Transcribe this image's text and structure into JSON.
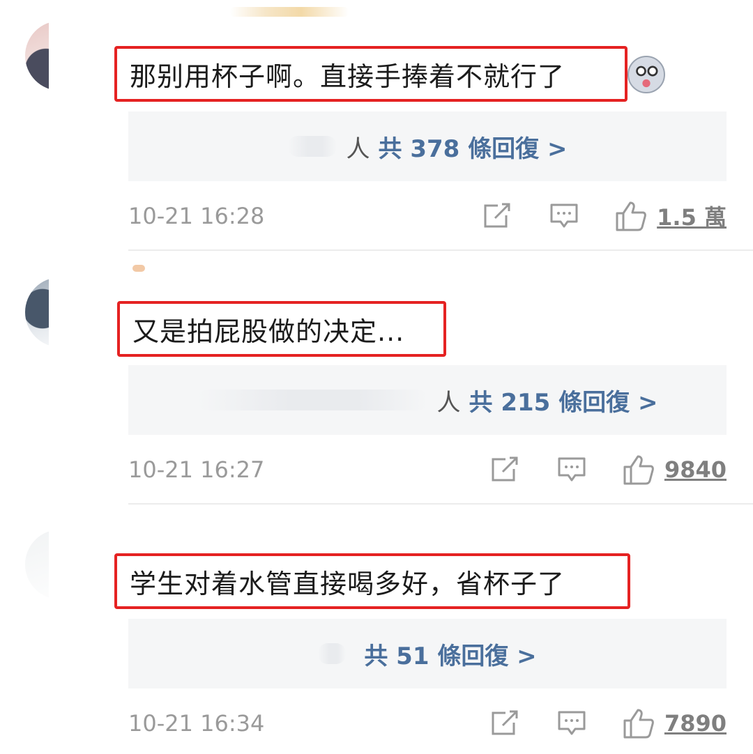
{
  "comments": [
    {
      "text": "那别用杯子啊。直接手捧着不就行了",
      "reply_person": "人",
      "reply_link": "共 378 條回復 >",
      "time": "10-21 16:28",
      "likes": "1.5 萬",
      "has_emoji": true,
      "emoji_icon": "husky-face-icon"
    },
    {
      "text": "又是拍屁股做的决定...",
      "reply_person": "人",
      "reply_link": "共 215 條回復 >",
      "time": "10-21 16:27",
      "likes": "9840"
    },
    {
      "text": "学生对着水管直接喝多好，省杯子了",
      "reply_person": "",
      "reply_link": "共 51 條回復 >",
      "time": "10-21 16:34",
      "likes": "7890"
    }
  ],
  "colors": {
    "highlight_box": "#e52222",
    "reply_link": "#4a6f9c",
    "meta_text": "#9a9a9a"
  }
}
